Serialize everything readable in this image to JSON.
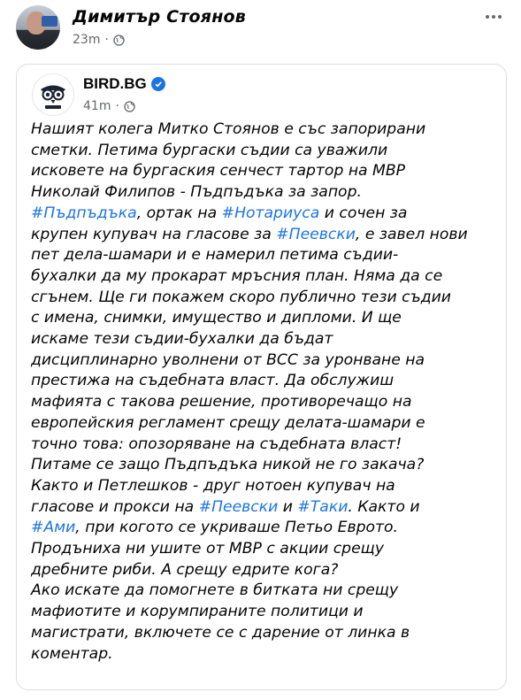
{
  "outer_post": {
    "author": "Димитър Стоянов",
    "time": "23m",
    "separator": "·"
  },
  "shared_post": {
    "page_name": "BIRD.BG",
    "time": "41m",
    "separator": "·",
    "segments": [
      {
        "t": "Нашият колега Митко Стоянов е със запорирани\nсметки. Петима бургаски съдии са уважили\nисковете на бургаския сенчест тартор на МВР\nНиколай Филипов - Пъдпъдъка за запор.\n"
      },
      {
        "t": "#Пъдпъдъка",
        "tag": true
      },
      {
        "t": ", ортак на "
      },
      {
        "t": "#Нотариуса",
        "tag": true
      },
      {
        "t": " и сочен за\nкрупен купувач на гласове за "
      },
      {
        "t": "#Пеевски",
        "tag": true
      },
      {
        "t": ", е завел нови\nпет дела-шамари и е намерил петима съдии-\nбухалки да му прокарат мръсния план. Няма да се\nсгънем. Ще ги покажем скоро публично тези съдии\nс имена, снимки, имущество и дипломи. И ще\nискаме тези съдии-бухалки да бъдат\nдисциплинарно уволнени от ВСС за уронване на\nпрестижа на съдебната власт. Да обслужиш\nмафията с такова решение, противоречащо на\nевропейския регламент срещу делата-шамари е\nточно това: опозоряване на съдебната власт!\nПитаме се защо Пъдпъдъка никой не го закача?\nКакто и Петлешков - друг нотоен купувач на\nгласове и прокси на "
      },
      {
        "t": "#Пеевски",
        "tag": true
      },
      {
        "t": " и "
      },
      {
        "t": "#Таки",
        "tag": true
      },
      {
        "t": ". Както и\n"
      },
      {
        "t": "#Ами",
        "tag": true
      },
      {
        "t": ", при когото се укриваше Петьо Еврото.\nПродъниха ни ушите от МВР с акции срещу\nдребните риби. А срещу едрите кога?\nАко искате да помогнете в битката ни срещу\nмафиотите и корумпираните политици и\nмагистрати, включете се с дарение от линка в\nкоментар."
      }
    ]
  },
  "colors": {
    "hashtag": "#1b74e4",
    "meta_text": "#65676b",
    "text": "#050505",
    "verified_badge": "#1b74e4"
  },
  "icons": [
    "globe-icon",
    "verified-badge-icon",
    "more-options-icon"
  ]
}
